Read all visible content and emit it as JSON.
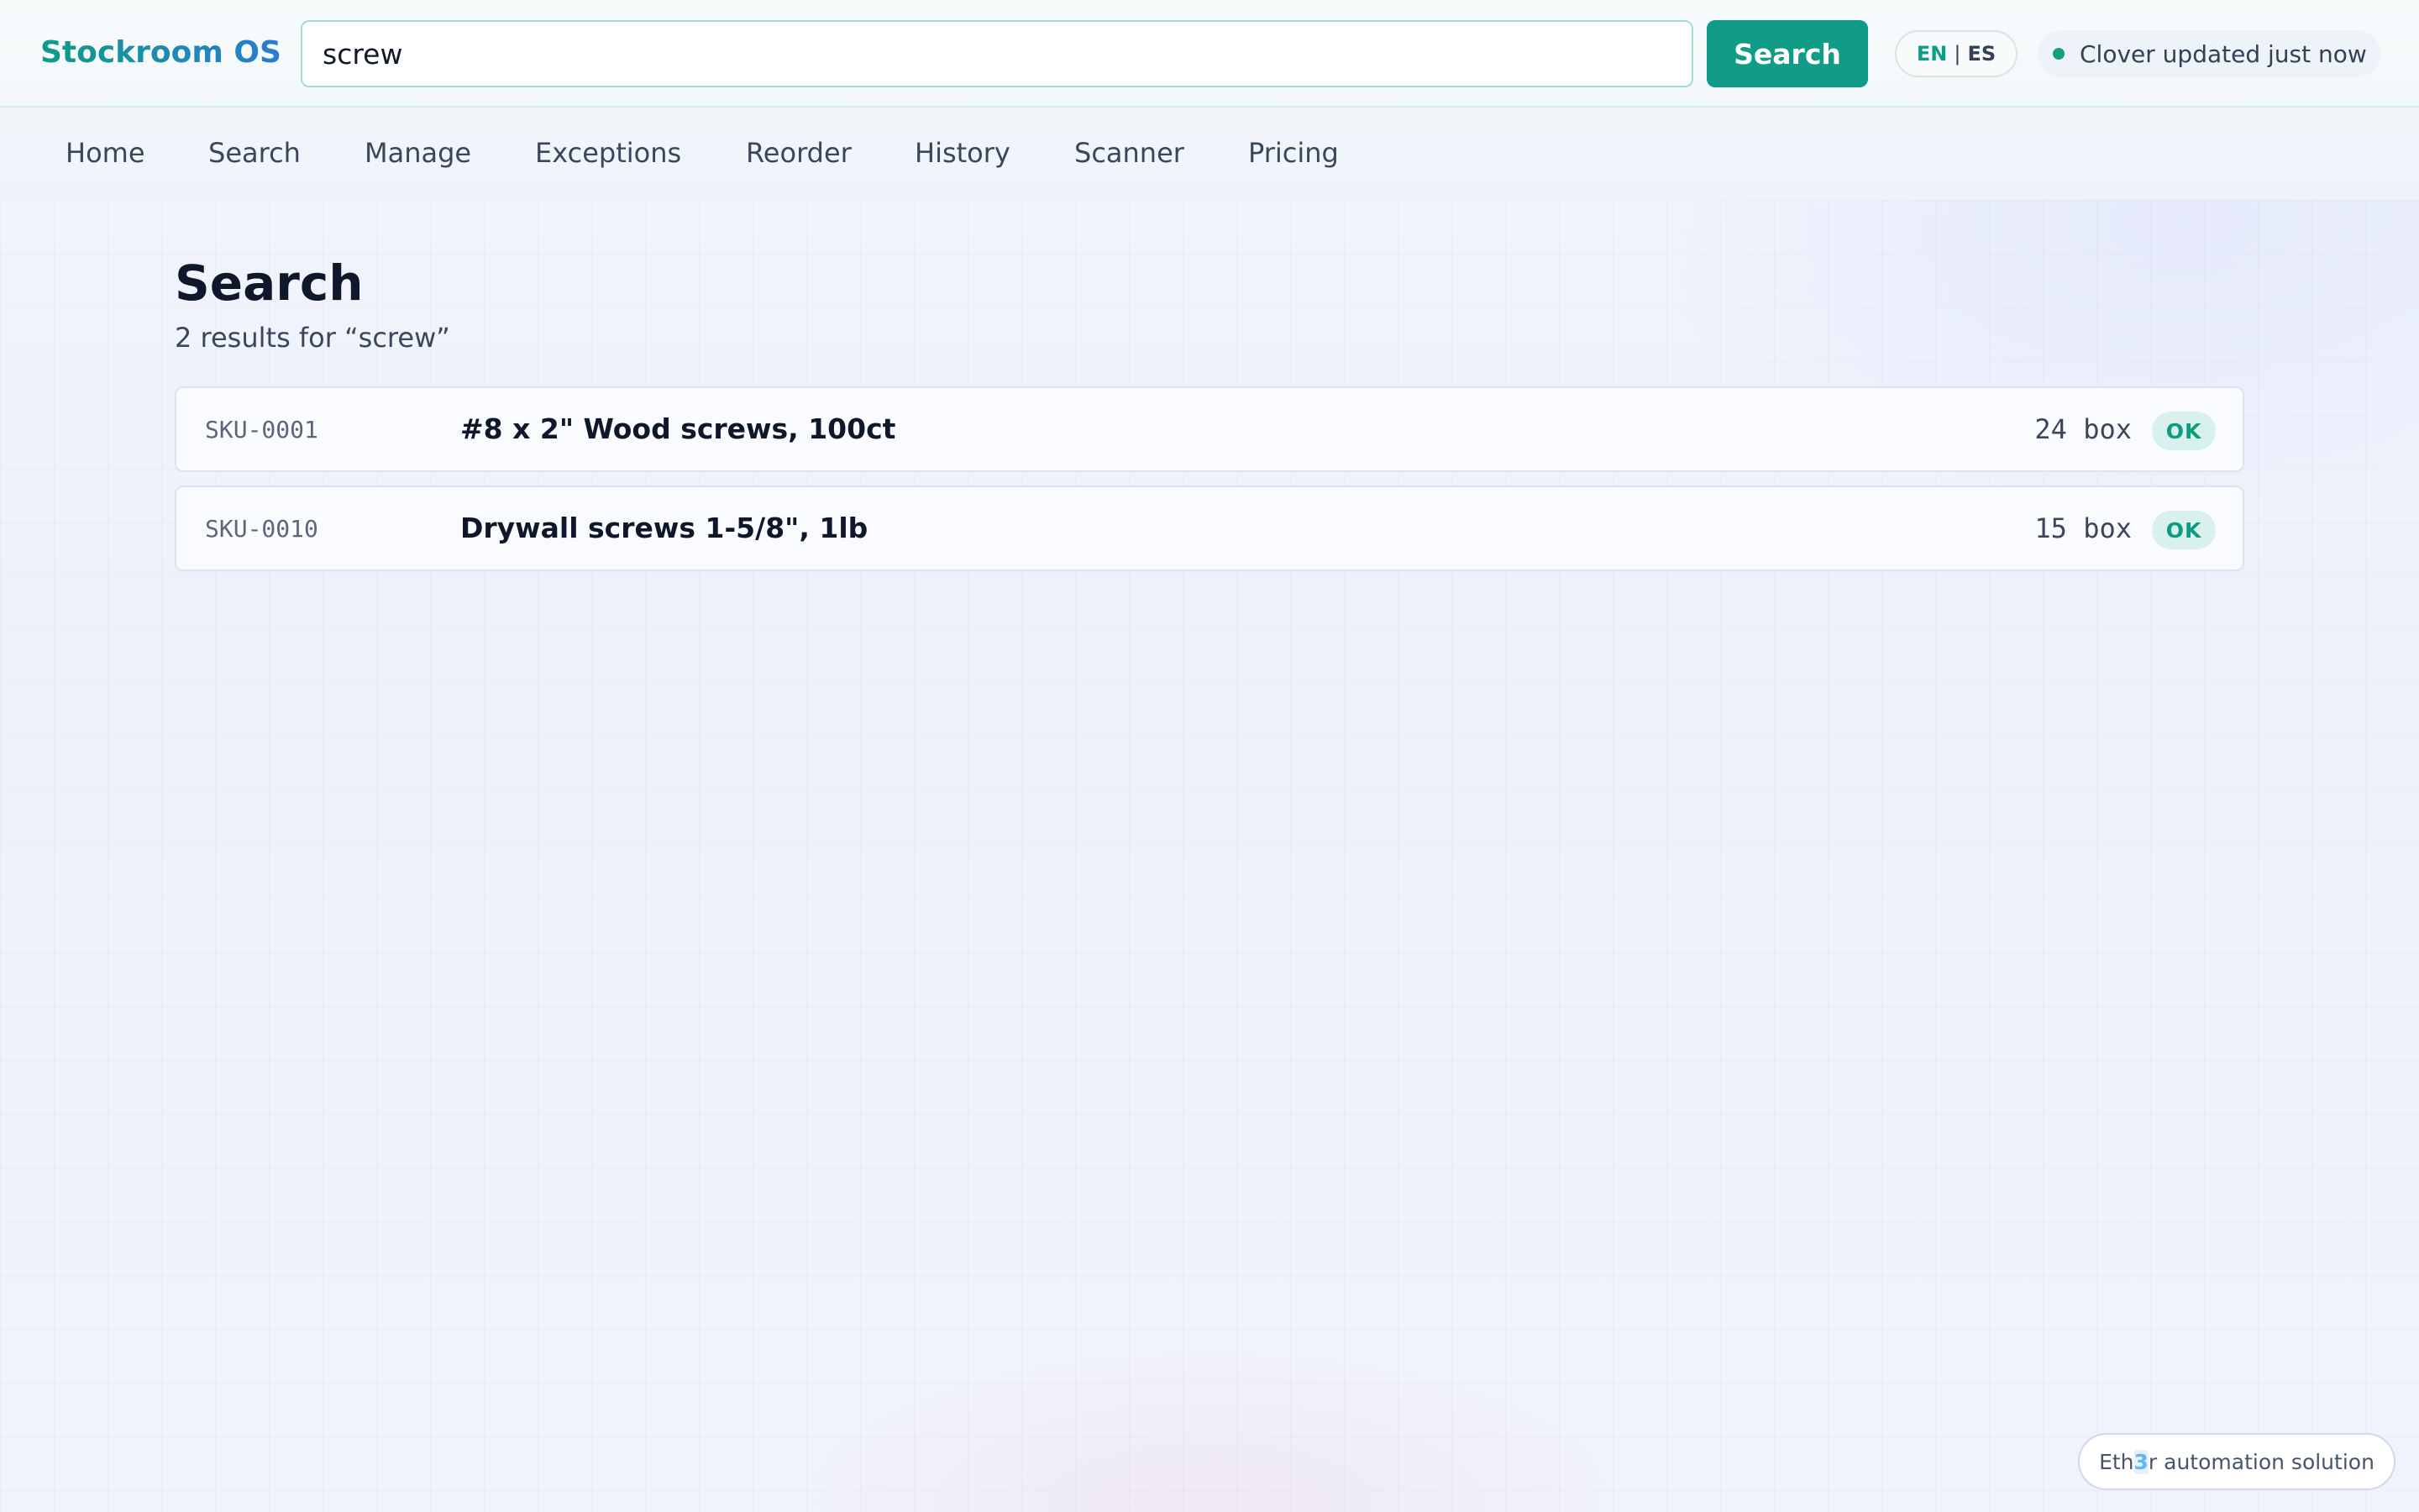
{
  "header": {
    "brand": "Stockroom OS",
    "search_value": "screw",
    "search_button": "Search",
    "lang": {
      "en": "EN",
      "separator": "|",
      "es": "ES"
    },
    "sync_status": "Clover updated just now",
    "sync_status_color": "#10a17e"
  },
  "nav": {
    "items": [
      "Home",
      "Search",
      "Manage",
      "Exceptions",
      "Reorder",
      "History",
      "Scanner",
      "Pricing"
    ]
  },
  "main": {
    "title": "Search",
    "summary": "2 results for “screw”",
    "results": [
      {
        "sku": "SKU-0001",
        "name": "#8 x 2\" Wood screws, 100ct",
        "qty": "24 box",
        "status": "OK"
      },
      {
        "sku": "SKU-0010",
        "name": "Drywall screws 1-5/8\", 1lb",
        "qty": "15 box",
        "status": "OK"
      }
    ]
  },
  "footer": {
    "badge_before": "Eth",
    "badge_highlight": "3",
    "badge_after": "r automation solution"
  },
  "colors": {
    "accent": "#109c86",
    "brand_gradient_start": "#0f9b88",
    "brand_gradient_end": "#2a7cd0",
    "status_ok_bg": "#d9f1ec",
    "status_ok_text": "#0f9b80"
  }
}
